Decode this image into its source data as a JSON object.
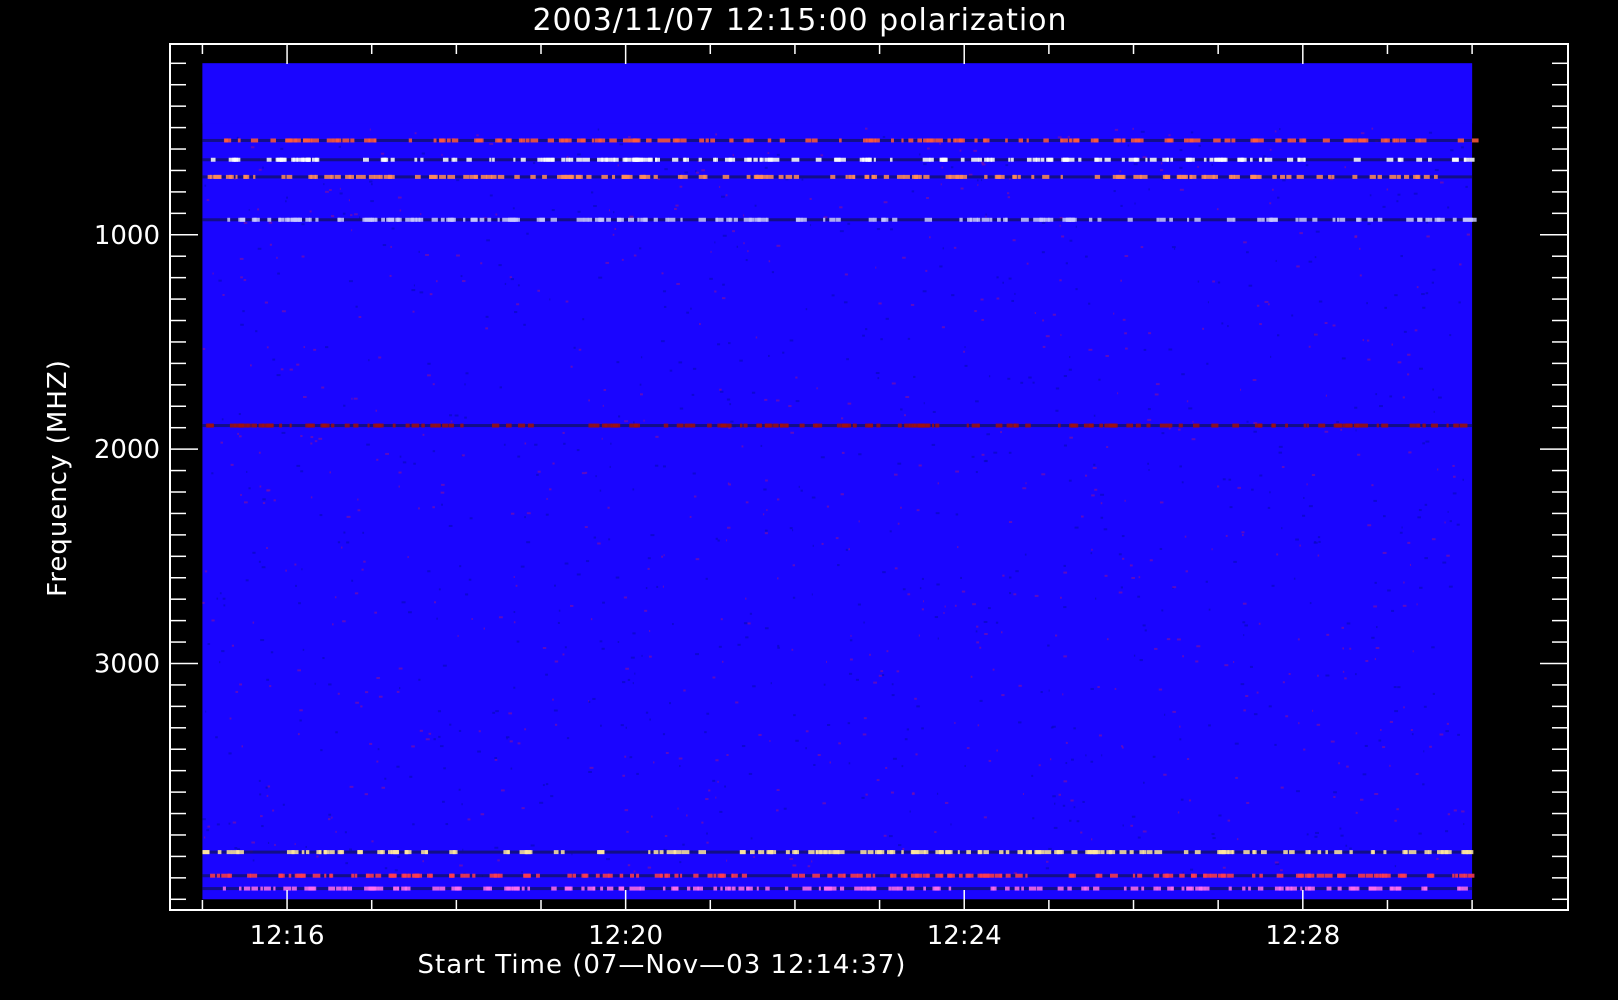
{
  "chart_data": {
    "type": "heatmap",
    "title": "2003/11/07 12:15:00 polarization",
    "xlabel": "Start Time (07—Nov—03 12:14:37)",
    "ylabel": "Frequency (MHZ)",
    "x_range_minutes": [
      12.25,
      12.5
    ],
    "x_ticks": [
      {
        "label": "12:16",
        "minute": 16
      },
      {
        "label": "12:20",
        "minute": 20
      },
      {
        "label": "12:24",
        "minute": 24
      },
      {
        "label": "12:28",
        "minute": 28
      }
    ],
    "x_minor_every_minutes": 1,
    "x_data_start_minute": 15,
    "x_data_end_minute": 30,
    "y_range": [
      110,
      4150
    ],
    "y_reversed": true,
    "y_ticks": [
      {
        "label": "1000",
        "value": 1000
      },
      {
        "label": "2000",
        "value": 2000
      },
      {
        "label": "3000",
        "value": 3000
      }
    ],
    "y_minor_every": 100,
    "data_freq_range": [
      200,
      4100
    ],
    "background_color": "#1a05ff",
    "features": [
      {
        "name": "masked-band",
        "freq_from": 200,
        "freq_to": 480,
        "color": "#1a05ff"
      },
      {
        "name": "rfi-band",
        "freq": 560,
        "color": "#ff5a3c"
      },
      {
        "name": "rfi-band",
        "freq": 650,
        "color": "#ffffff"
      },
      {
        "name": "rfi-band",
        "freq": 730,
        "color": "#ff8c5a"
      },
      {
        "name": "rfi-band",
        "freq": 930,
        "color": "#c8c8ff"
      },
      {
        "name": "rfi-band",
        "freq": 1890,
        "color": "#a01010"
      },
      {
        "name": "rfi-band",
        "freq": 3880,
        "color": "#ffe6a0"
      },
      {
        "name": "rfi-band",
        "freq": 3990,
        "color": "#ff3c50"
      },
      {
        "name": "rfi-band",
        "freq": 4050,
        "color": "#ff6ef0"
      }
    ]
  }
}
